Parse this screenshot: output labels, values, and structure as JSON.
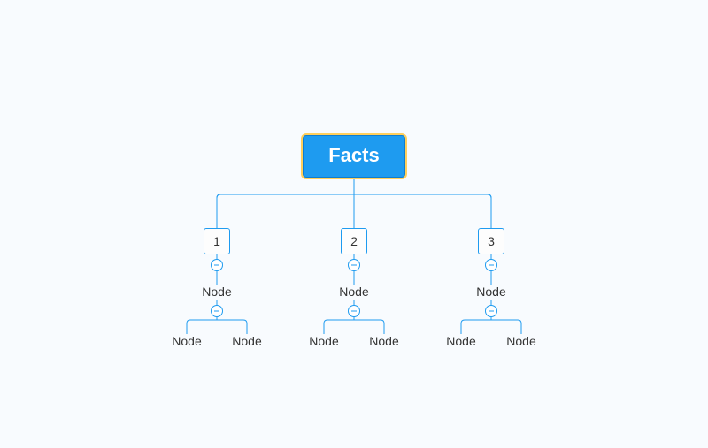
{
  "diagram": {
    "root_label": "Facts",
    "branches": [
      {
        "number": "1",
        "child": "Node",
        "grandchildren": [
          "Node",
          "Node"
        ]
      },
      {
        "number": "2",
        "child": "Node",
        "grandchildren": [
          "Node",
          "Node"
        ]
      },
      {
        "number": "3",
        "child": "Node",
        "grandchildren": [
          "Node",
          "Node"
        ]
      }
    ]
  },
  "colors": {
    "canvas_bg": "#f8fbfe",
    "root_fill": "#1e9bf0",
    "root_border": "#0e7dd0",
    "root_highlight": "#ffcf5c",
    "line": "#1e9bf0",
    "text": "#333333"
  }
}
